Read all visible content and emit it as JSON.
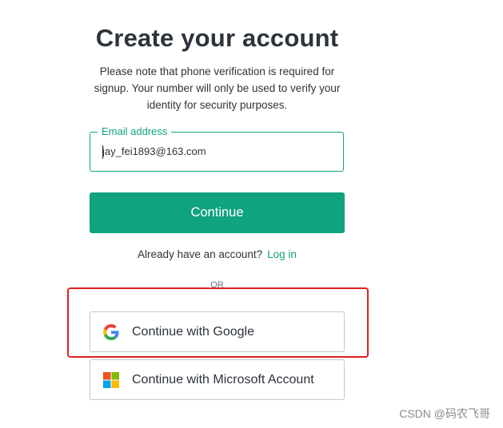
{
  "header": {
    "title": "Create your account",
    "subtitle": "Please note that phone verification is required for signup. Your number will only be used to verify your identity for security purposes."
  },
  "email": {
    "label": "Email address",
    "value": "jay_fei1893@163.com"
  },
  "actions": {
    "continue_label": "Continue",
    "login_prompt": "Already have an account?",
    "login_link": "Log in",
    "divider": "OR"
  },
  "social": {
    "google_label": "Continue with Google",
    "google_icon": "google-icon",
    "microsoft_label": "Continue with Microsoft Account",
    "microsoft_icon": "microsoft-icon"
  },
  "annotation": {
    "highlight_color": "#e02020"
  },
  "colors": {
    "accent": "#10a37f",
    "text": "#2d333a",
    "border": "#c2c8d0"
  },
  "watermark": "CSDN @码农飞哥"
}
